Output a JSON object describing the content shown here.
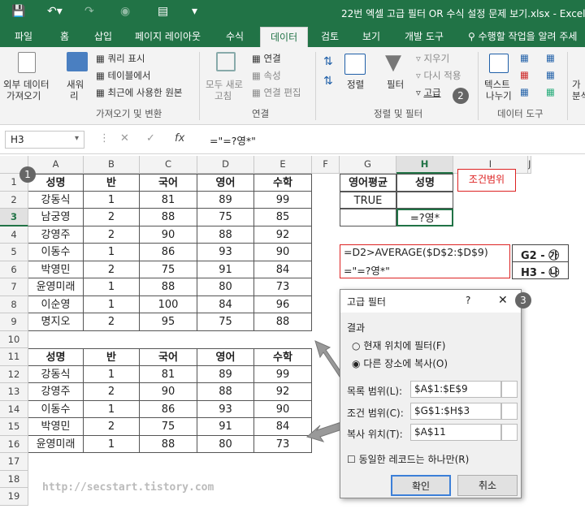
{
  "window_title": "22번 엑셀 고급 필터 OR 수식 설정 문제 보기.xlsx - Excel",
  "tabs": [
    "파일",
    "홈",
    "삽입",
    "페이지 레이아웃",
    "수식",
    "데이터",
    "검토",
    "보기",
    "개발 도구"
  ],
  "tell_me": "수행할 작업을 알려 주세",
  "ribbon": {
    "get_external": {
      "label1": "외부 데이터",
      "label2": "가져오기"
    },
    "new_query": {
      "label1": "새워",
      "label2": "리"
    },
    "query_items": [
      "쿼리 표시",
      "테이블에서",
      "최근에 사용한 원본"
    ],
    "group1": "가져오기 및 변환",
    "refresh": {
      "label1": "모두 새로",
      "label2": "고침"
    },
    "conn_items": [
      "연결",
      "속성",
      "연결 편집"
    ],
    "group2": "연결",
    "sort_label": "정렬",
    "filter_label": "필터",
    "filter_items": [
      "지우기",
      "다시 적용",
      "고급"
    ],
    "group3": "정렬 및 필터",
    "text_to_col": {
      "label1": "텍스트",
      "label2": "나누기"
    },
    "group4": "데이터 도구",
    "extra1": "가",
    "extra2": "분석"
  },
  "name_box": "H3",
  "formula": "=\"=?영*\"",
  "col_headers": [
    "A",
    "B",
    "C",
    "D",
    "E",
    "F",
    "G",
    "H",
    "I",
    "J"
  ],
  "row_numbers": [
    "1",
    "2",
    "3",
    "4",
    "5",
    "6",
    "7",
    "8",
    "9",
    "10",
    "11",
    "12",
    "13",
    "14",
    "15",
    "16",
    "17",
    "18",
    "19"
  ],
  "table1": {
    "headers": [
      "성명",
      "반",
      "국어",
      "영어",
      "수학"
    ],
    "rows": [
      [
        "강동식",
        "1",
        "81",
        "89",
        "99"
      ],
      [
        "남궁영",
        "2",
        "88",
        "75",
        "85"
      ],
      [
        "강영주",
        "2",
        "90",
        "88",
        "92"
      ],
      [
        "이동수",
        "1",
        "86",
        "93",
        "90"
      ],
      [
        "박영민",
        "2",
        "75",
        "91",
        "84"
      ],
      [
        "윤영미래",
        "1",
        "88",
        "80",
        "73"
      ],
      [
        "이순영",
        "1",
        "100",
        "84",
        "96"
      ],
      [
        "명지오",
        "2",
        "95",
        "75",
        "88"
      ]
    ]
  },
  "table2": {
    "headers": [
      "성명",
      "반",
      "국어",
      "영어",
      "수학"
    ],
    "rows": [
      [
        "강동식",
        "1",
        "81",
        "89",
        "99"
      ],
      [
        "강영주",
        "2",
        "90",
        "88",
        "92"
      ],
      [
        "이동수",
        "1",
        "86",
        "93",
        "90"
      ],
      [
        "박영민",
        "2",
        "75",
        "91",
        "84"
      ],
      [
        "윤영미래",
        "1",
        "88",
        "80",
        "73"
      ]
    ]
  },
  "criteria": {
    "headers": [
      "영어평균",
      "성명"
    ],
    "g2": "TRUE",
    "h3": "=?영*",
    "label": "조건범위"
  },
  "notes": {
    "f1": "=D2>AVERAGE($D$2:$D$9)",
    "f2": "=\"=?영*\"",
    "l1": "G2 - ㉮",
    "l2": "H3 - ㉯"
  },
  "dialog": {
    "title": "고급 필터",
    "help": "?",
    "close": "✕",
    "result_label": "결과",
    "opt1": "현재 위치에 필터(F)",
    "opt2": "다른 장소에 복사(O)",
    "list_label": "목록 범위(L):",
    "list_value": "$A$1:$E$9",
    "crit_label": "조건 범위(C):",
    "crit_value": "$G$1:$H$3",
    "copy_label": "복사 위치(T):",
    "copy_value": "$A$11",
    "unique_label": "동일한 레코드는 하나만(R)",
    "ok": "확인",
    "cancel": "취소"
  },
  "badges": [
    "1",
    "2",
    "3"
  ],
  "watermark": "http://secstart.tistory.com",
  "colors": {
    "excel_green": "#217346",
    "highlight_red": "#d22"
  }
}
